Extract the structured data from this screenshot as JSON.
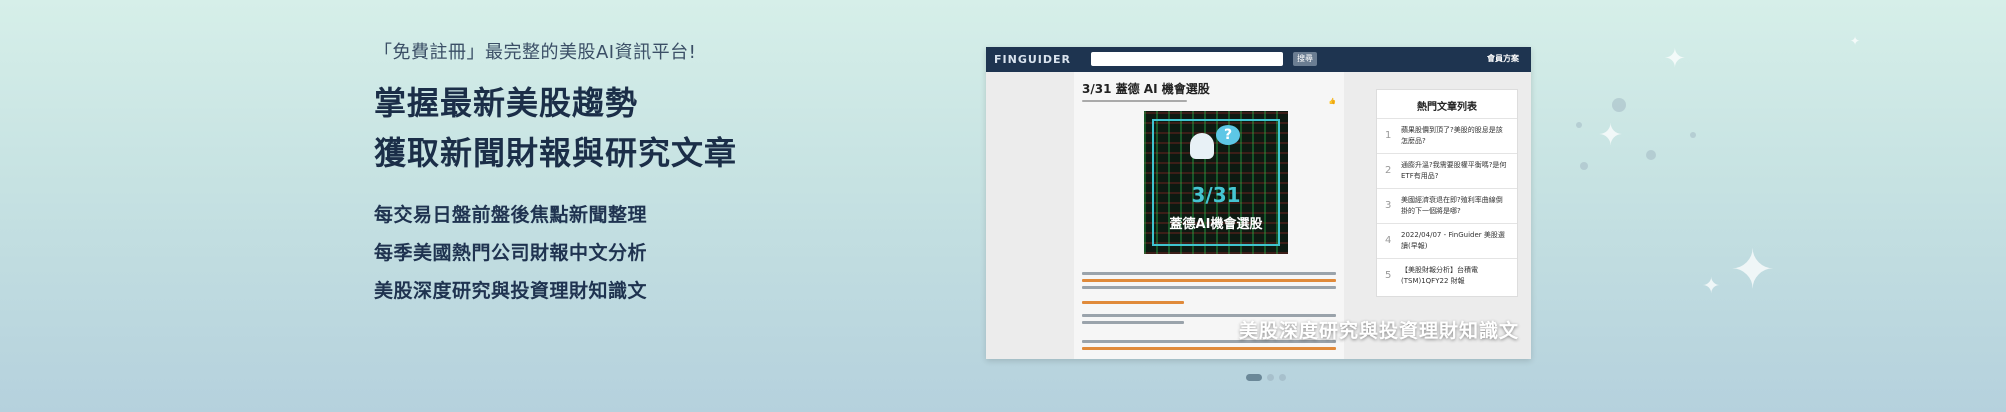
{
  "hero": {
    "tagline": "「免費註冊」最完整的美股AI資訊平台!",
    "headlines": [
      "掌握最新美股趨勢",
      "獲取新聞財報與研究文章"
    ],
    "features": [
      "每交易日盤前盤後焦點新聞整理",
      "每季美國熱門公司財報中文分析",
      "美股深度研究與投資理財知識文"
    ]
  },
  "carousel": {
    "caption": "美股深度研究與投資理財知識文",
    "active_index": 0,
    "slide_count": 3,
    "screenshot": {
      "logo": "FINGUIDER",
      "search_button": "搜尋",
      "member_link": "會員方案",
      "article_title": "3/31 蓋德 AI 機會選股",
      "hero_date": "3/31",
      "hero_title": "蓋德AI機會選股",
      "sidebar_title": "熱門文章列表",
      "sidebar_items": [
        {
          "num": "1",
          "text": "蘋果股價到頂了?美股的股息是該怎麼品?"
        },
        {
          "num": "2",
          "text": "通膨升溫?我需要股權平衡嗎?是何ETF有用品?"
        },
        {
          "num": "3",
          "text": "美國經濟衰退在即?殖利率曲線倒掛的下一個將是哪?"
        },
        {
          "num": "4",
          "text": "2022/04/07 - FinGuider 美股選讀(早報)"
        },
        {
          "num": "5",
          "text": "【美股財報分析】台積電(TSM)1QFY22 財報"
        }
      ]
    }
  },
  "colors": {
    "accent": "#1e3450",
    "highlight": "#45c5d2"
  }
}
